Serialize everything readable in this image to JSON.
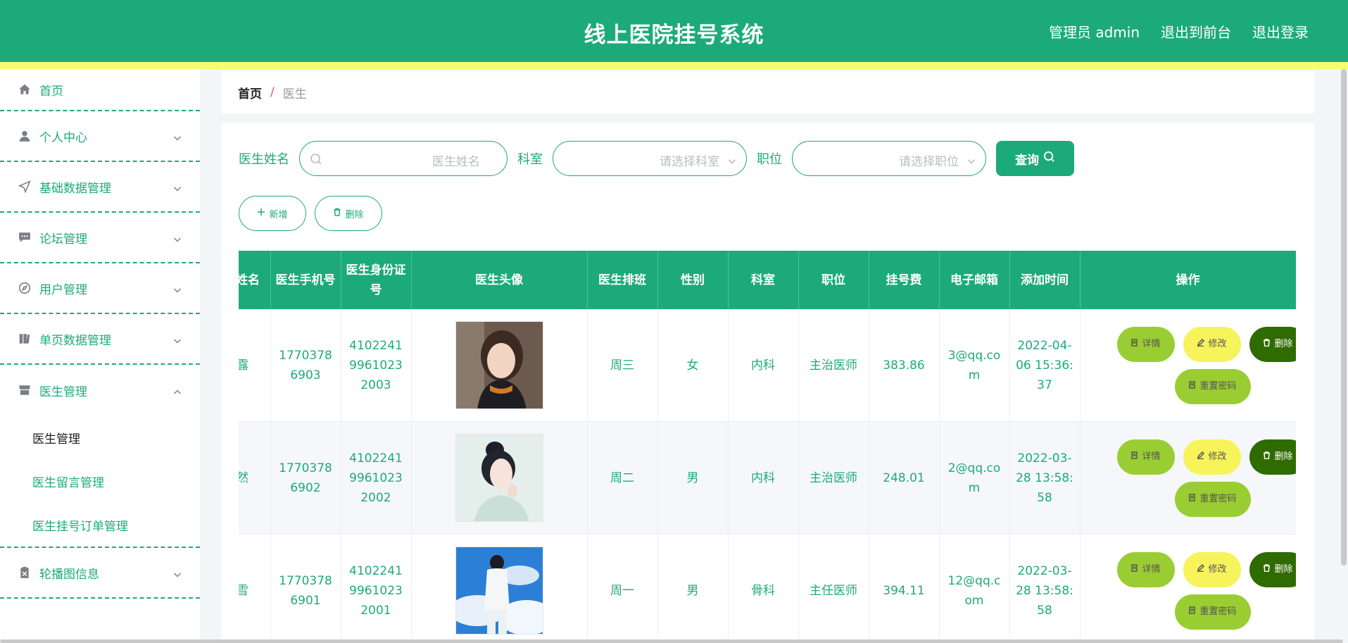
{
  "header": {
    "title": "线上医院挂号系统",
    "admin_label": "管理员 admin",
    "to_front": "退出到前台",
    "logout": "退出登录"
  },
  "colors": {
    "primary": "#1daa7b",
    "stripe": "#f5fd6e",
    "detail": "#9acd32",
    "edit": "#f7f35a",
    "delete": "#2e6b00"
  },
  "sidebar": {
    "items": [
      {
        "label": "首页",
        "icon": "home-icon"
      },
      {
        "label": "个人中心",
        "icon": "user-icon"
      },
      {
        "label": "基础数据管理",
        "icon": "send-icon"
      },
      {
        "label": "论坛管理",
        "icon": "chat-icon"
      },
      {
        "label": "用户管理",
        "icon": "compass-icon"
      },
      {
        "label": "单页数据管理",
        "icon": "book-icon"
      },
      {
        "label": "医生管理",
        "icon": "shop-icon"
      },
      {
        "label": "轮播图信息",
        "icon": "clipboard-icon"
      }
    ],
    "submenu": [
      "医生管理",
      "医生留言管理",
      "医生挂号订单管理"
    ]
  },
  "breadcrumb": {
    "home": "首页",
    "sep": "/",
    "current": "医生"
  },
  "search": {
    "name_label": "医生姓名",
    "name_placeholder": "医生姓名",
    "dept_label": "科室",
    "dept_placeholder": "请选择科室",
    "pos_label": "职位",
    "pos_placeholder": "请选择职位",
    "query": "查询"
  },
  "actions": {
    "add": "新增",
    "delete": "删除"
  },
  "table": {
    "columns": [
      "姓名",
      "医生手机号",
      "医生身份证号",
      "医生头像",
      "医生排班",
      "性别",
      "科室",
      "职位",
      "挂号费",
      "电子邮箱",
      "添加时间",
      "操作"
    ],
    "ops": {
      "detail": "详情",
      "edit": "修改",
      "delete": "删除",
      "reset": "重置密码"
    },
    "rows": [
      {
        "name": "露",
        "phone": "17703786903",
        "idcard": "410224199610232003",
        "avatar": "woman-portrait",
        "schedule": "周三",
        "gender": "女",
        "dept": "内科",
        "position": "主治医师",
        "fee": "383.86",
        "email": "3@qq.com",
        "time": "2022-04-06 15:36:37"
      },
      {
        "name": "然",
        "phone": "17703786902",
        "idcard": "410224199610232002",
        "avatar": "woman-portrait-light",
        "schedule": "周二",
        "gender": "男",
        "dept": "内科",
        "position": "主治医师",
        "fee": "248.01",
        "email": "2@qq.com",
        "time": "2022-03-28 13:58:58"
      },
      {
        "name": "雪",
        "phone": "17703786901",
        "idcard": "410224199610232001",
        "avatar": "sky-figure",
        "schedule": "周一",
        "gender": "男",
        "dept": "骨科",
        "position": "主任医师",
        "fee": "394.11",
        "email": "12@qq.com",
        "time": "2022-03-28 13:58:58"
      }
    ]
  }
}
